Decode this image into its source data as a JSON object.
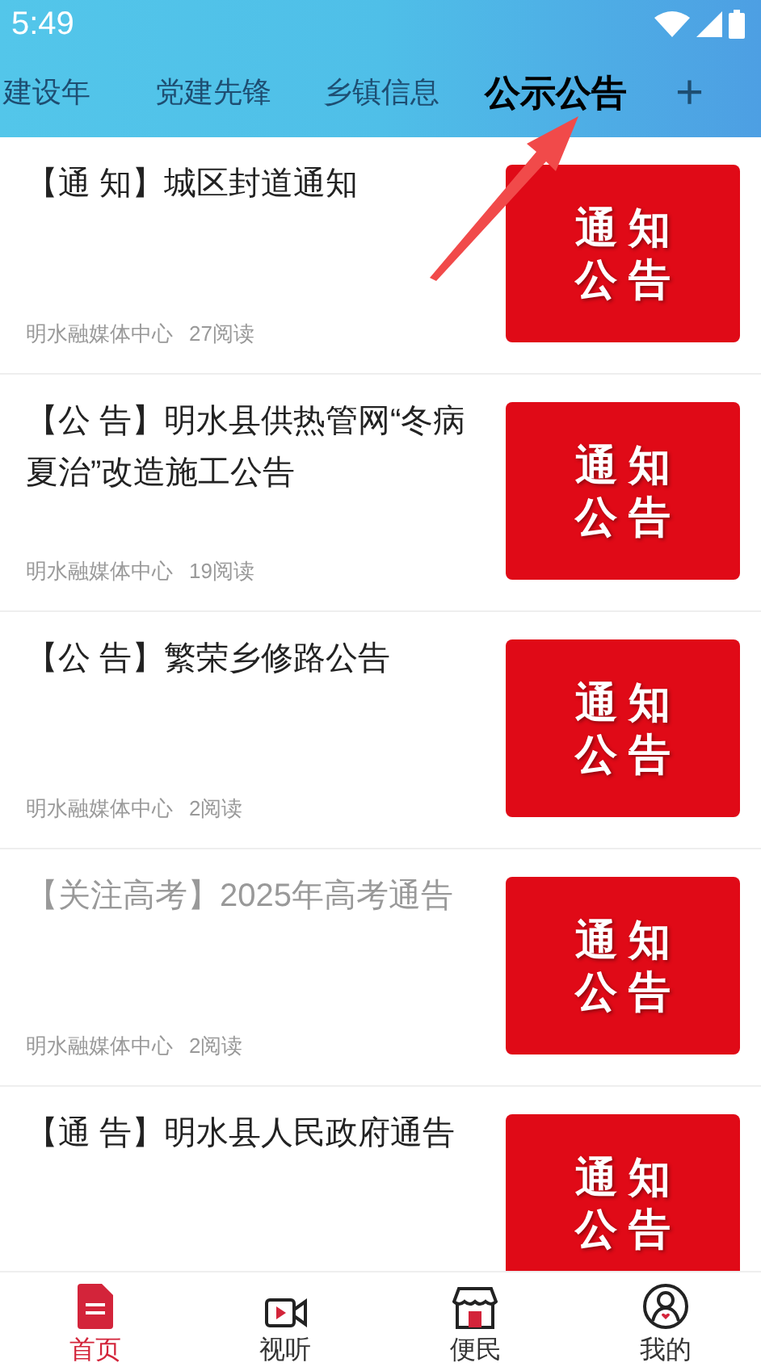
{
  "status_bar": {
    "time": "5:49"
  },
  "tabs": [
    {
      "label": "建设年",
      "selected": false
    },
    {
      "label": "党建先锋",
      "selected": false
    },
    {
      "label": "乡镇信息",
      "selected": false
    },
    {
      "label": "公示公告",
      "selected": true
    }
  ],
  "add_tab": "+",
  "articles": [
    {
      "title": "【通 知】城区封道通知",
      "read": false,
      "source": "明水融媒体中心",
      "views": "27阅读",
      "thumb_lines": [
        "通 知",
        "公 告"
      ]
    },
    {
      "title": "【公 告】明水县供热管网“冬病夏治”改造施工公告",
      "read": false,
      "source": "明水融媒体中心",
      "views": "19阅读",
      "thumb_lines": [
        "通 知",
        "公 告"
      ]
    },
    {
      "title": "【公 告】繁荣乡修路公告",
      "read": false,
      "source": "明水融媒体中心",
      "views": "2阅读",
      "thumb_lines": [
        "通 知",
        "公 告"
      ]
    },
    {
      "title": "【关注高考】2025年高考通告",
      "read": true,
      "source": "明水融媒体中心",
      "views": "2阅读",
      "thumb_lines": [
        "通 知",
        "公 告"
      ]
    },
    {
      "title": "【通 告】明水县人民政府通告",
      "read": false,
      "thumb_lines": [
        "通 知",
        "公 告"
      ]
    }
  ],
  "bottom_nav": [
    {
      "label": "首页",
      "kind": "home",
      "selected": true
    },
    {
      "label": "视听",
      "kind": "video",
      "selected": false
    },
    {
      "label": "便民",
      "kind": "store",
      "selected": false
    },
    {
      "label": "我的",
      "kind": "profile",
      "selected": false
    }
  ]
}
